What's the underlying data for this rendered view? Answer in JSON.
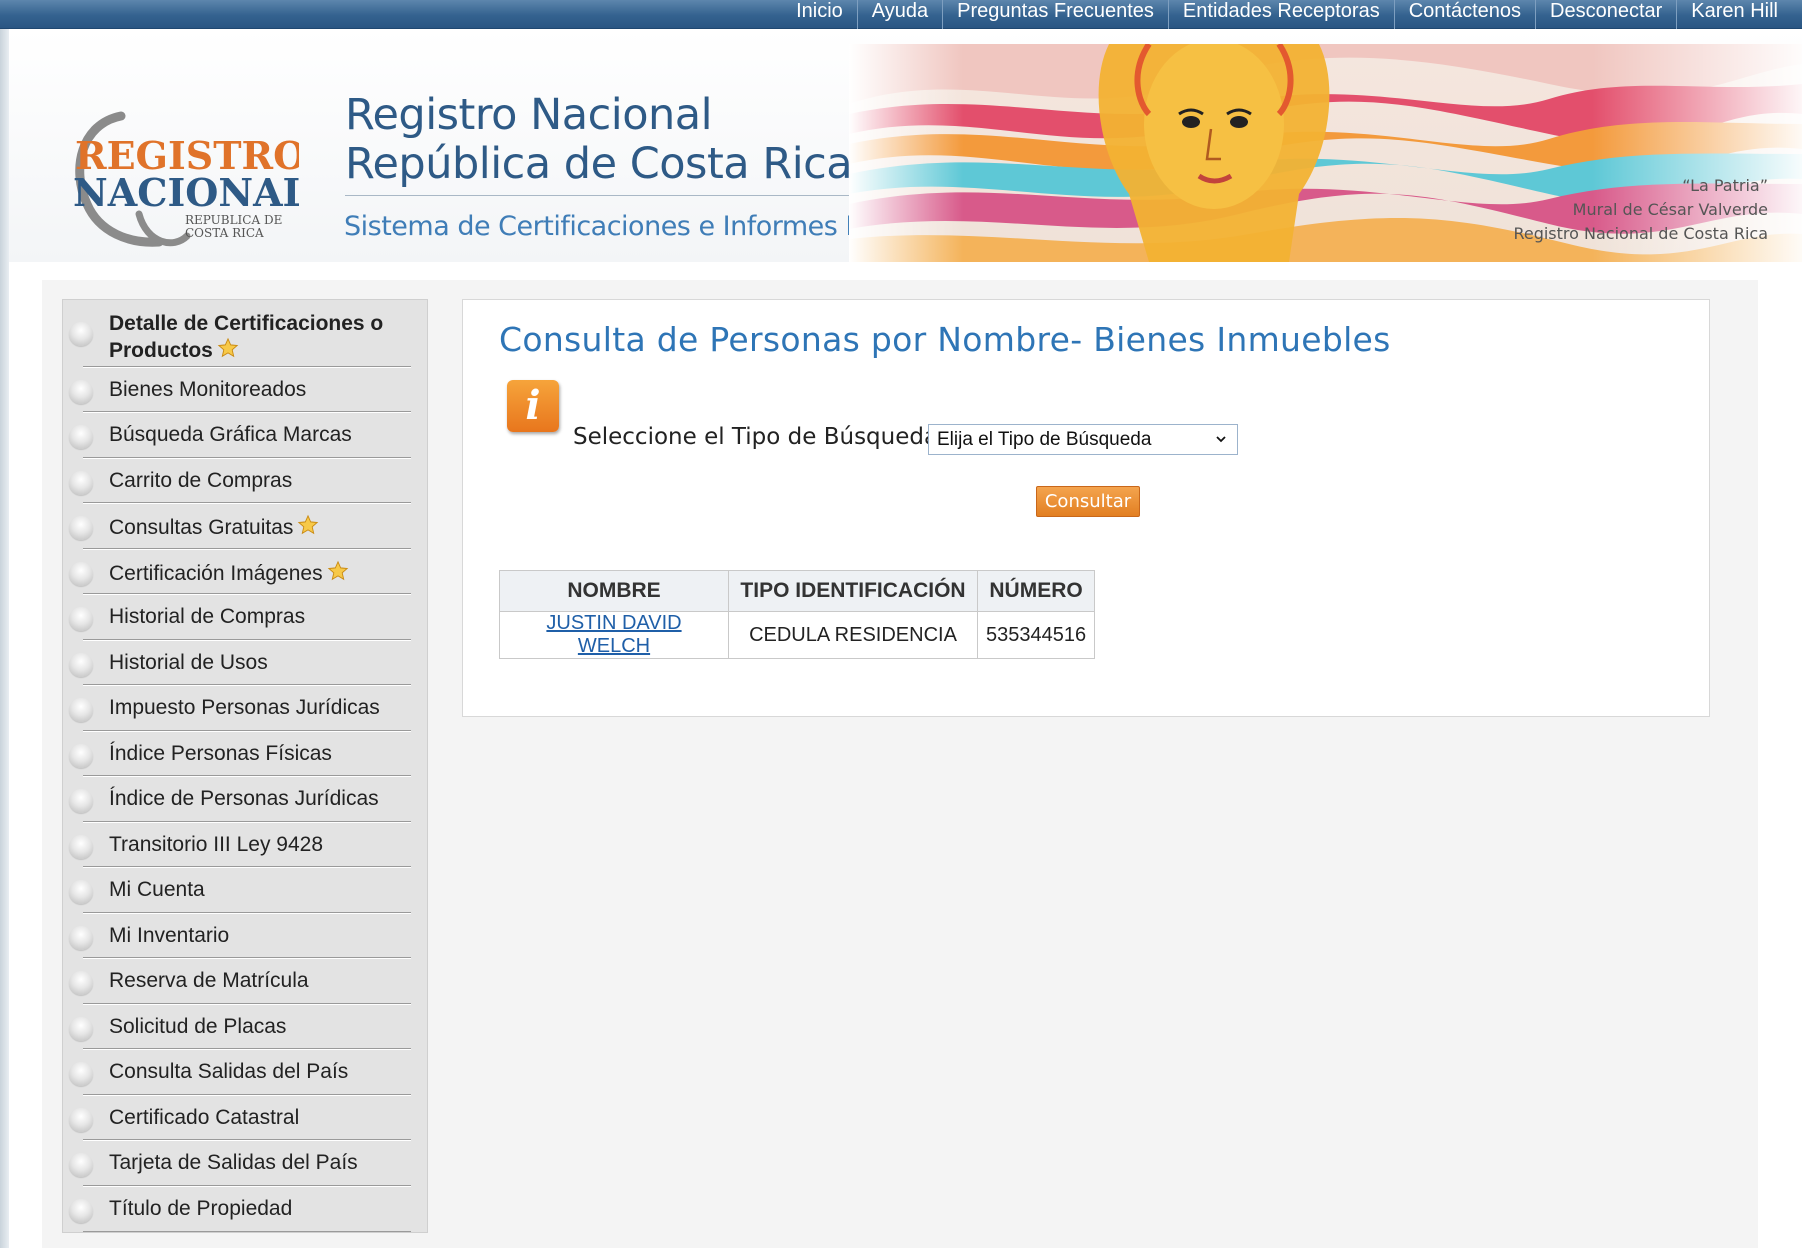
{
  "topnav": {
    "items": [
      "Inicio",
      "Ayuda",
      "Preguntas Frecuentes",
      "Entidades Receptoras",
      "Contáctenos",
      "Desconectar",
      "Karen Hill"
    ]
  },
  "header": {
    "logo_text_line1": "REGISTRO",
    "logo_text_line2": "NACIONAL",
    "logo_text_line3": "REPUBLICA DE",
    "logo_text_line4": "COSTA RICA",
    "title_line1": "Registro Nacional",
    "title_line2": "República de Costa Rica",
    "subtitle": "Sistema de Certificaciones e Informes Digitales",
    "credit_line1": "“La Patria”",
    "credit_line2": "Mural de César Valverde",
    "credit_line3": "Registro Nacional de Costa Rica"
  },
  "sidebar": {
    "items": [
      {
        "label_line1": "Detalle de Certificaciones o",
        "label_line2": "Productos",
        "star": true
      },
      {
        "label": "Bienes Monitoreados",
        "star": false
      },
      {
        "label": "Búsqueda Gráfica Marcas",
        "star": false
      },
      {
        "label": "Carrito de Compras",
        "star": false
      },
      {
        "label": "Consultas Gratuitas",
        "star": true
      },
      {
        "label": "Certificación Imágenes",
        "star": true
      },
      {
        "label": "Historial de Compras",
        "star": false
      },
      {
        "label": "Historial de Usos",
        "star": false
      },
      {
        "label": "Impuesto Personas Jurídicas",
        "star": false
      },
      {
        "label": "Índice Personas Físicas",
        "star": false
      },
      {
        "label": "Índice de Personas Jurídicas",
        "star": false
      },
      {
        "label": "Transitorio III Ley 9428",
        "star": false
      },
      {
        "label": "Mi Cuenta",
        "star": false
      },
      {
        "label": "Mi Inventario",
        "star": false
      },
      {
        "label": "Reserva de Matrícula",
        "star": false
      },
      {
        "label": "Solicitud de Placas",
        "star": false
      },
      {
        "label": "Consulta Salidas del País",
        "star": false
      },
      {
        "label": "Certificado Catastral",
        "star": false
      },
      {
        "label": "Tarjeta de Salidas del País",
        "star": false
      },
      {
        "label": "Título de Propiedad",
        "star": false
      }
    ]
  },
  "main": {
    "title": "Consulta de Personas por Nombre- Bienes Inmuebles",
    "info_icon_glyph": "i",
    "search_label": "Seleccione el Tipo de Búsqueda:",
    "search_select_value": "Elija el Tipo de Búsqueda",
    "submit_label": "Consultar",
    "table": {
      "headers": [
        "NOMBRE",
        "TIPO IDENTIFICACIÓN",
        "NÚMERO"
      ],
      "rows": [
        [
          "JUSTIN DAVID WELCH",
          "CEDULA RESIDENCIA",
          "535344516"
        ]
      ]
    }
  },
  "colors": {
    "nav_bar": "#34628f",
    "title_blue": "#2e75b6",
    "button_orange": "#e8761d",
    "link_blue": "#1f5fa8"
  }
}
